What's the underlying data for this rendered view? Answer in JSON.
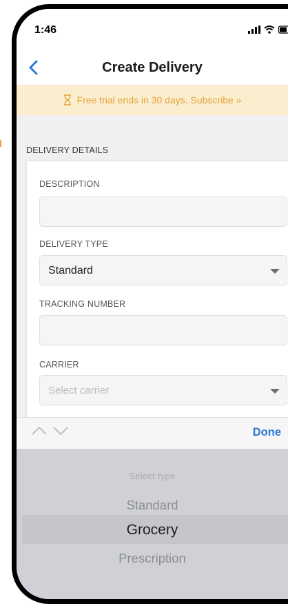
{
  "status_bar": {
    "time": "1:46"
  },
  "nav": {
    "title": "Create Delivery"
  },
  "trial_banner": {
    "text": "Free trial ends in 30 days. Subscribe »"
  },
  "section": {
    "title": "DELIVERY DETAILS"
  },
  "form": {
    "description": {
      "label": "DESCRIPTION",
      "value": ""
    },
    "delivery_type": {
      "label": "DELIVERY TYPE",
      "value": "Standard"
    },
    "tracking_number": {
      "label": "TRACKING NUMBER",
      "value": ""
    },
    "carrier": {
      "label": "CARRIER",
      "placeholder": "Select carrier"
    }
  },
  "keyboard_accessory": {
    "done_label": "Done"
  },
  "picker": {
    "prompt": "Select type",
    "options": [
      "Standard",
      "Grocery",
      "Prescription"
    ],
    "selected": "Grocery"
  },
  "colors": {
    "accent": "#2a77d5",
    "banner_bg": "#fbeecf",
    "banner_text": "#e3a23a"
  },
  "icons": [
    "back-chevron-icon",
    "hourglass-icon",
    "signal-icon",
    "wifi-icon",
    "battery-icon",
    "chevron-up-icon",
    "chevron-down-icon",
    "dropdown-caret-icon"
  ]
}
